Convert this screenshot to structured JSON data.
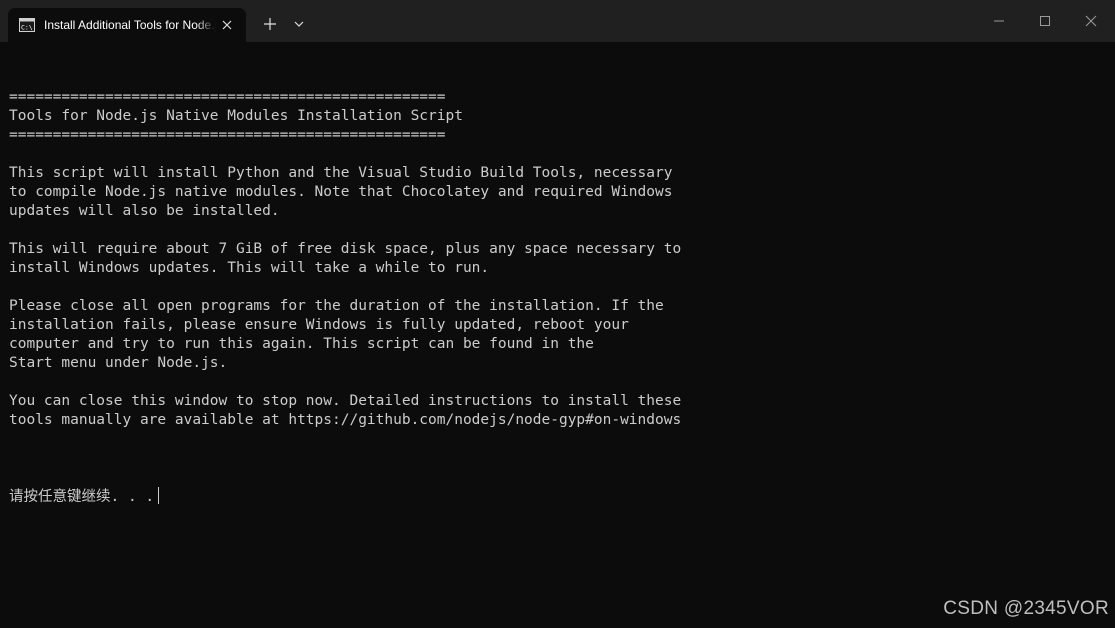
{
  "window": {
    "tab_title": "Install Additional Tools for Node.js",
    "tab_icon": "terminal-icon",
    "close_tab_icon": "close-icon",
    "new_tab_icon": "plus-icon",
    "dropdown_icon": "chevron-down-icon",
    "controls": [
      "minimize-icon",
      "maximize-icon",
      "close-icon"
    ]
  },
  "terminal": {
    "lines": [
      "==================================================",
      "Tools for Node.js Native Modules Installation Script",
      "==================================================",
      "",
      "This script will install Python and the Visual Studio Build Tools, necessary",
      "to compile Node.js native modules. Note that Chocolatey and required Windows",
      "updates will also be installed.",
      "",
      "This will require about 7 GiB of free disk space, plus any space necessary to",
      "install Windows updates. This will take a while to run.",
      "",
      "Please close all open programs for the duration of the installation. If the",
      "installation fails, please ensure Windows is fully updated, reboot your",
      "computer and try to run this again. This script can be found in the",
      "Start menu under Node.js.",
      "",
      "You can close this window to stop now. Detailed instructions to install these",
      "tools manually are available at https://github.com/nodejs/node-gyp#on-windows",
      ""
    ],
    "prompt": "请按任意键继续. . ."
  },
  "watermark": "CSDN @2345VOR",
  "colors": {
    "background": "#0c0c0c",
    "titlebar": "#202020",
    "text": "#cccccc"
  }
}
